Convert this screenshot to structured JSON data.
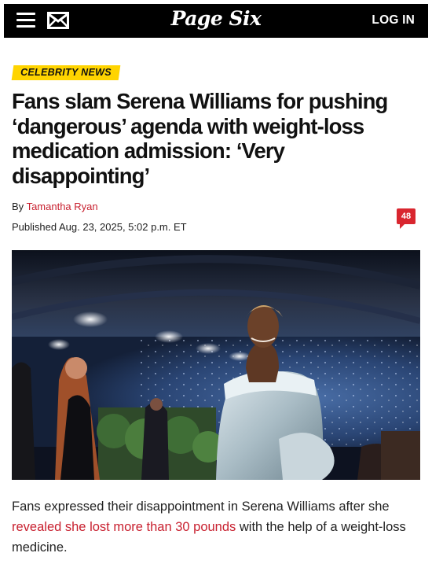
{
  "header": {
    "logo": "Page Six",
    "login_label": "LOG IN",
    "menu_icon": "hamburger-menu-icon",
    "mail_icon": "mail-envelope-icon"
  },
  "article": {
    "category": "CELEBRITY NEWS",
    "headline": "Fans slam Serena Williams for pushing ‘dangerous’ agenda with weight-loss medication admission: ‘Very disappointing’",
    "byline_prefix": "By",
    "author": "Tamantha Ryan",
    "published": "Published Aug. 23, 2025, 5:02 p.m. ET",
    "comment_count": "48",
    "dek_before": "Fans expressed their disappointment in Serena Williams after she",
    "dek_link": "revealed she lost more than 30 pounds",
    "dek_after": "with the help of a weight-loss medicine."
  },
  "colors": {
    "header_bg": "#000000",
    "accent_red": "#c8202f",
    "badge_yellow": "#ffd400"
  }
}
